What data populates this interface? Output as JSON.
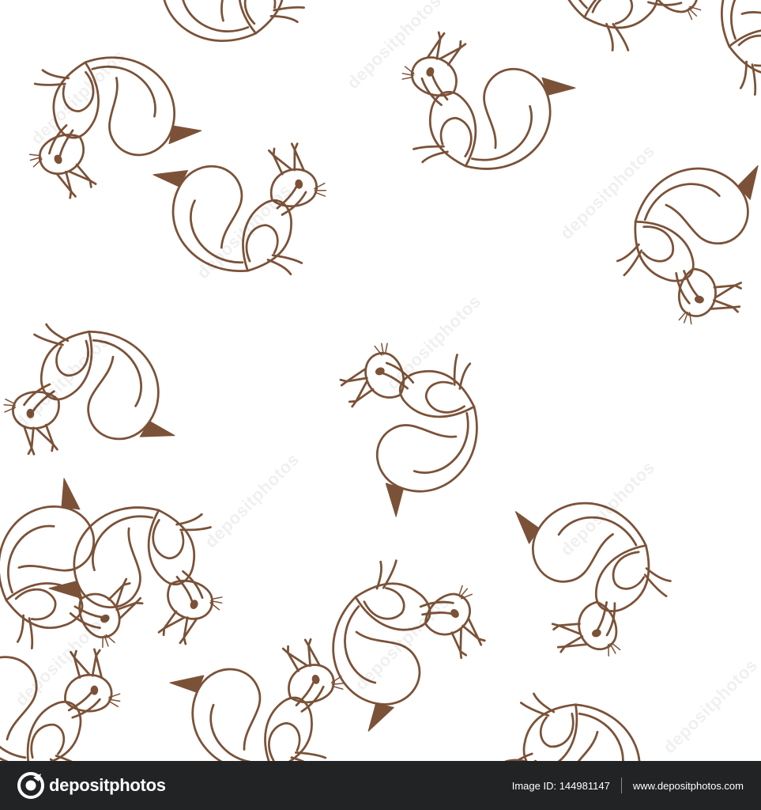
{
  "colors": {
    "outline": "#7b5238",
    "tail_tip": "#7b5238",
    "background": "#ffffff",
    "footer_background": "#222325",
    "footer_text": "#ffffff"
  },
  "artwork": {
    "subject": "squirrel",
    "watermark_text": "depositphotos"
  },
  "footer": {
    "brand_name": "depositphotos",
    "image_id_text": "Image ID: 144981147",
    "url": "www.depositphotos.com"
  }
}
